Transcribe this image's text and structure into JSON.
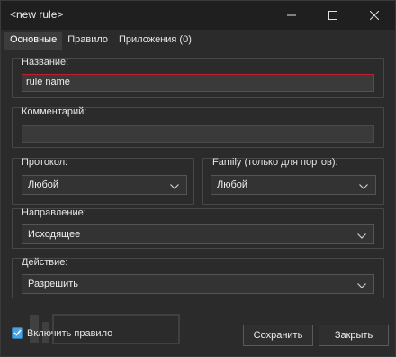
{
  "window": {
    "title": "<new rule>"
  },
  "tabs": [
    {
      "label": "Основные",
      "active": true
    },
    {
      "label": "Правило",
      "active": false
    },
    {
      "label": "Приложения (0)",
      "active": false
    }
  ],
  "name_group": {
    "label": "Название:",
    "value": "rule name"
  },
  "comment_group": {
    "label": "Комментарий:",
    "value": ""
  },
  "protocol_group": {
    "label": "Протокол:",
    "selected": "Любой"
  },
  "family_group": {
    "label": "Family (только для портов):",
    "selected": "Любой"
  },
  "direction_group": {
    "label": "Направление:",
    "selected": "Исходящее"
  },
  "action_group": {
    "label": "Действие:",
    "selected": "Разрешить"
  },
  "footer": {
    "enable_label": "Включить правило",
    "enable_checked": true,
    "save_label": "Сохранить",
    "close_label": "Закрыть"
  },
  "colors": {
    "background": "#2b2b2b",
    "titlebar": "#1f1f1f",
    "focus_border": "#c21d2f",
    "checkbox_accent": "#4aa3df"
  },
  "icons": {
    "minimize": "minimize-icon",
    "maximize": "maximize-icon",
    "close": "close-icon",
    "dropdown": "chevron-down-icon",
    "check": "check-icon"
  }
}
